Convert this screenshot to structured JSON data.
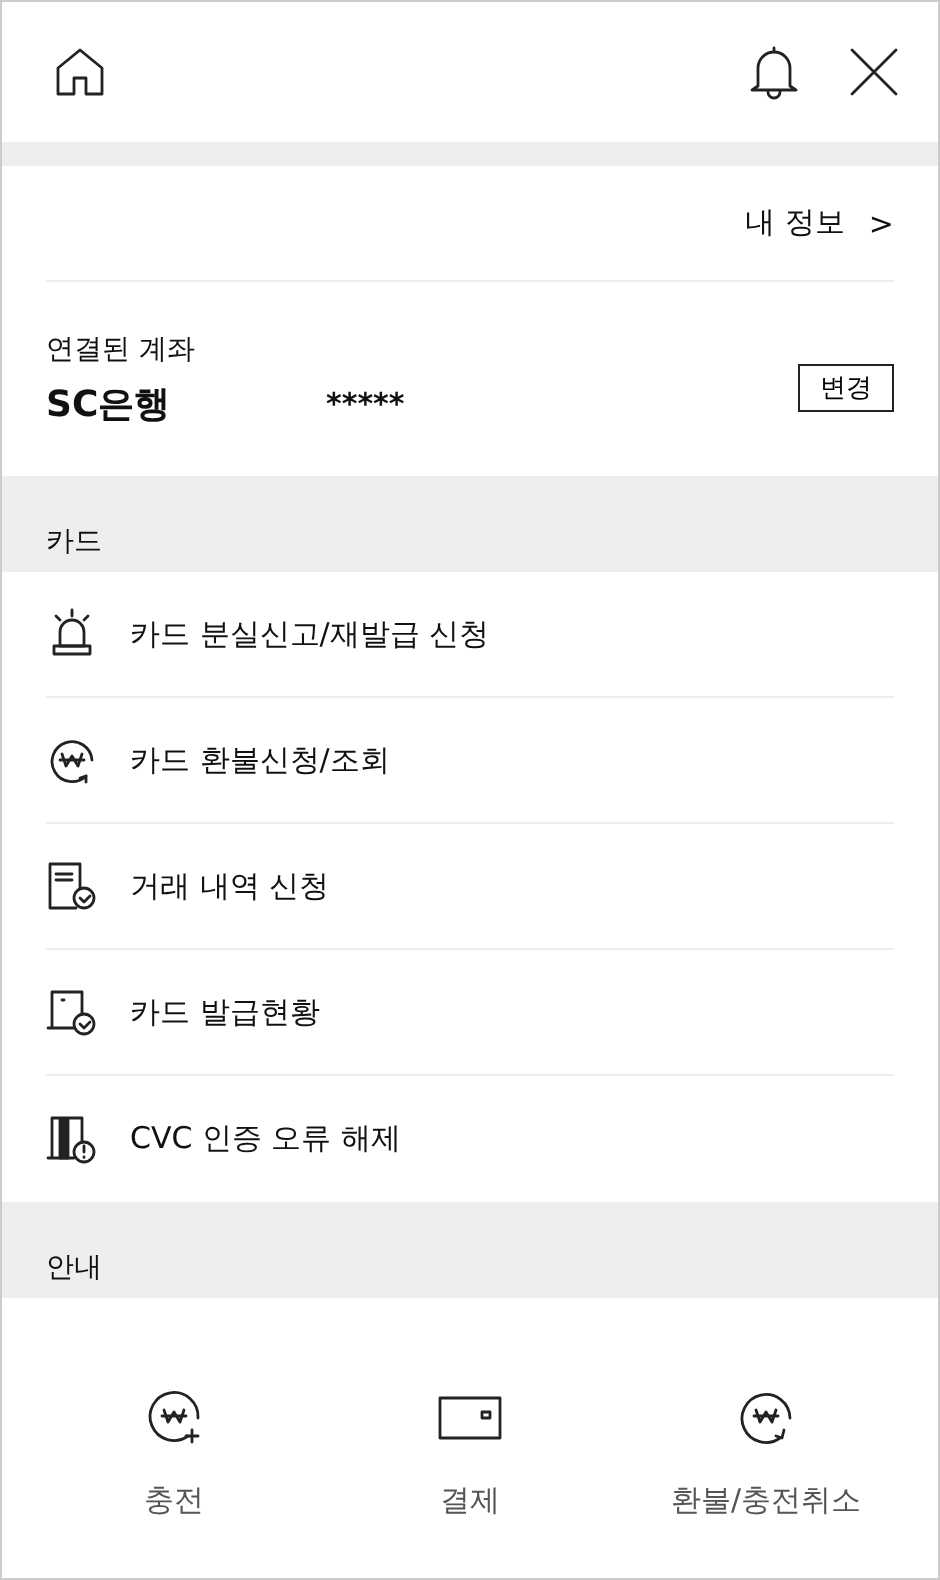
{
  "my_info_link": {
    "label": "내 정보",
    "chevron": ">"
  },
  "account": {
    "label": "연결된 계좌",
    "bank": "SC은행",
    "number": "*****",
    "change_button": "변경"
  },
  "card_section": {
    "title": "카드",
    "items": [
      {
        "label": "카드 분실신고/재발급 신청"
      },
      {
        "label": "카드 환불신청/조회"
      },
      {
        "label": "거래 내역 신청"
      },
      {
        "label": "카드 발급현황"
      },
      {
        "label": "CVC 인증 오류 해제"
      }
    ]
  },
  "info_section": {
    "title": "안내"
  },
  "bottom_actions": [
    {
      "label": "충전"
    },
    {
      "label": "결제"
    },
    {
      "label": "환불/충전취소"
    }
  ]
}
